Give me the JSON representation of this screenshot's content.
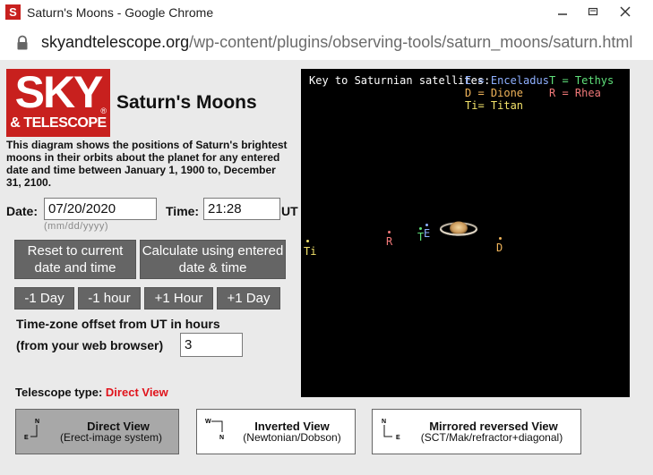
{
  "window": {
    "title": "Saturn's Moons - Google Chrome",
    "app_icon_letter": "S"
  },
  "address": {
    "host": "skyandtelescope.org",
    "path": "/wp-content/plugins/observing-tools/saturn_moons/saturn.html"
  },
  "logo": {
    "line1": "SKY",
    "line2": "& TELESCOPE",
    "registered": "®"
  },
  "page": {
    "title": "Saturn's Moons",
    "description": "This diagram shows the positions of Saturn's brightest moons in their orbits about the planet for any entered date and time between January 1, 1900 to, December 31, 2100."
  },
  "form": {
    "date_label": "Date:",
    "date_value": "07/20/2020",
    "date_hint": "(mm/dd/yyyy)",
    "time_label": "Time:",
    "time_value": "21:28",
    "time_unit": "UT",
    "reset_button": "Reset to current date and time",
    "calculate_button": "Calculate using entered date & time",
    "step_buttons": [
      "-1 Day",
      "-1 hour",
      "+1 Hour",
      "+1 Day"
    ],
    "tz_line1": "Time-zone offset from UT in hours",
    "tz_line2": "(from your web browser)",
    "tz_value": "3"
  },
  "telescope": {
    "label": "Telescope type:",
    "value": "Direct View",
    "value_color": "#e0141c",
    "views": [
      {
        "title": "Direct View",
        "subtitle": "(Erect-image system)",
        "selected": true,
        "compass": [
          "N",
          "E"
        ]
      },
      {
        "title": "Inverted View",
        "subtitle": "(Newtonian/Dobson)",
        "selected": false,
        "compass": [
          "W",
          "N"
        ]
      },
      {
        "title": "Mirrored reversed View",
        "subtitle": "(SCT/Mak/refractor+diagonal)",
        "selected": false,
        "compass": [
          "N",
          "E"
        ]
      }
    ]
  },
  "diagram": {
    "key_title": "Key to Saturnian satellites:",
    "key_entries": [
      {
        "text": "E = Enceladus",
        "color": "#8fb0ff"
      },
      {
        "text": "T = Tethys",
        "color": "#5fe07a"
      },
      {
        "text": "D = Dione",
        "color": "#f0b45a"
      },
      {
        "text": "R = Rhea",
        "color": "#f07878"
      },
      {
        "text": "Ti= Titan",
        "color": "#f2e26a"
      }
    ],
    "moons": [
      {
        "label": "Ti",
        "color": "#f2e26a"
      },
      {
        "label": "R",
        "color": "#f07878"
      },
      {
        "label": "T",
        "color": "#5fe07a"
      },
      {
        "label": "E",
        "color": "#8fb0ff"
      },
      {
        "label": "D",
        "color": "#f0b45a"
      }
    ]
  },
  "colors": {
    "page_background": "#eaeaea",
    "button_gray": "#656565",
    "logo_red": "#c8201e"
  }
}
